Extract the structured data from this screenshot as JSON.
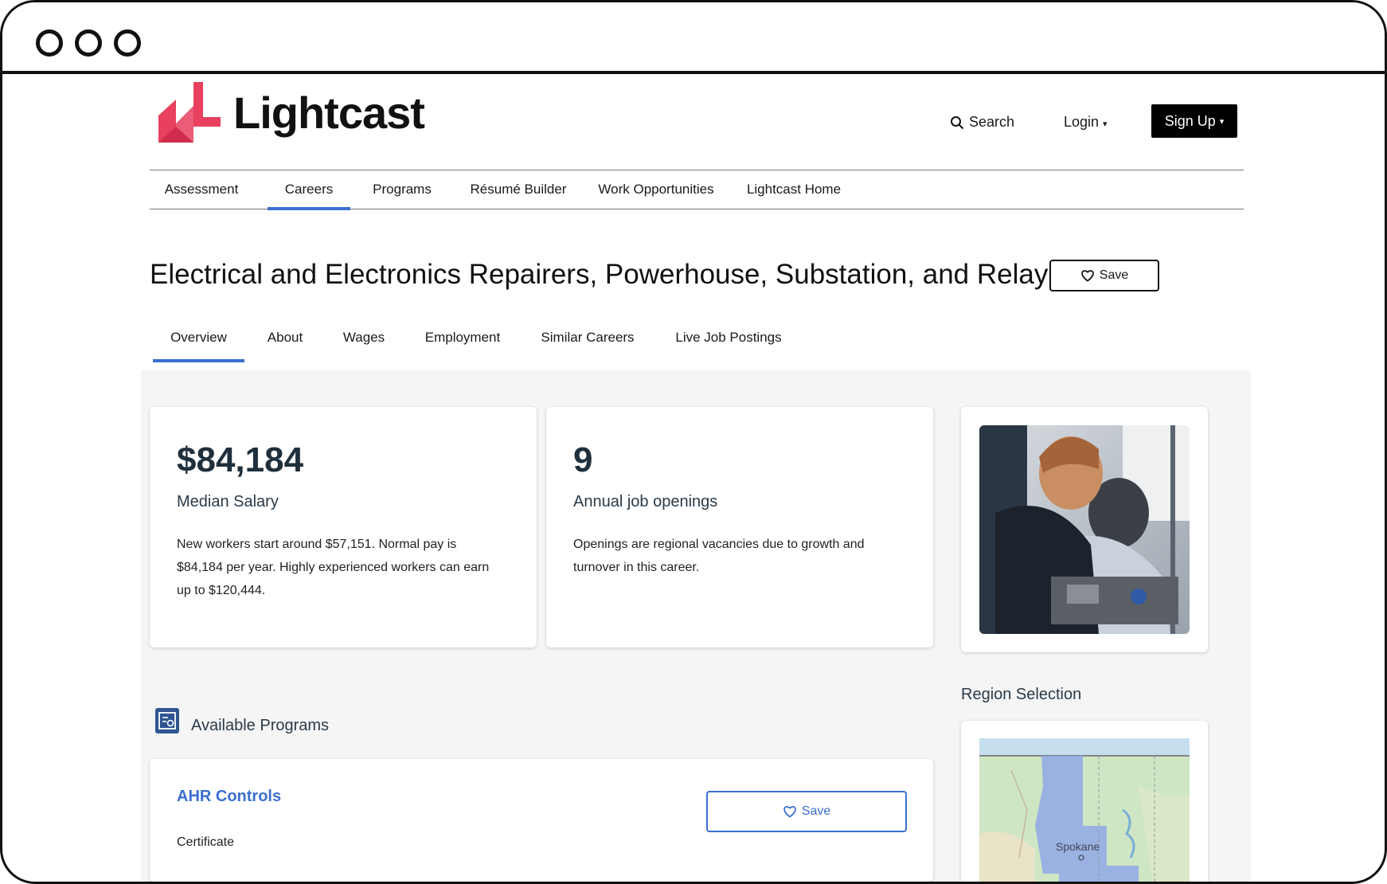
{
  "brand": {
    "name": "Lightcast",
    "accent": "#e8405e"
  },
  "header": {
    "search_label": "Search",
    "login_label": "Login",
    "signup_label": "Sign Up"
  },
  "mainnav": {
    "items": [
      {
        "label": "Assessment"
      },
      {
        "label": "Careers",
        "active": true
      },
      {
        "label": "Programs"
      },
      {
        "label": "Résumé Builder"
      },
      {
        "label": "Work Opportunities"
      },
      {
        "label": "Lightcast Home"
      }
    ]
  },
  "career": {
    "title": "Electrical and Electronics Repairers, Powerhouse, Substation, and Relay",
    "save_label": "Save"
  },
  "subtabs": {
    "items": [
      {
        "label": "Overview",
        "active": true
      },
      {
        "label": "About"
      },
      {
        "label": "Wages"
      },
      {
        "label": "Employment"
      },
      {
        "label": "Similar Careers"
      },
      {
        "label": "Live Job Postings"
      }
    ]
  },
  "salary": {
    "value": "$84,184",
    "label": "Median Salary",
    "description": "New workers start around $57,151. Normal pay is $84,184 per year. Highly experienced workers can earn up to $120,444."
  },
  "openings": {
    "value": "9",
    "label": "Annual job openings",
    "description": "Openings are regional vacancies due to growth and turnover in this career."
  },
  "programs": {
    "heading": "Available Programs",
    "items": [
      {
        "title": "AHR Controls",
        "type": "Certificate",
        "save_label": "Save"
      }
    ]
  },
  "region": {
    "heading": "Region Selection",
    "map_label": "Spokane"
  },
  "colors": {
    "link": "#3a6fd0",
    "heading_dark": "#1f2f3c",
    "panel_bg": "#f5f5f6"
  }
}
